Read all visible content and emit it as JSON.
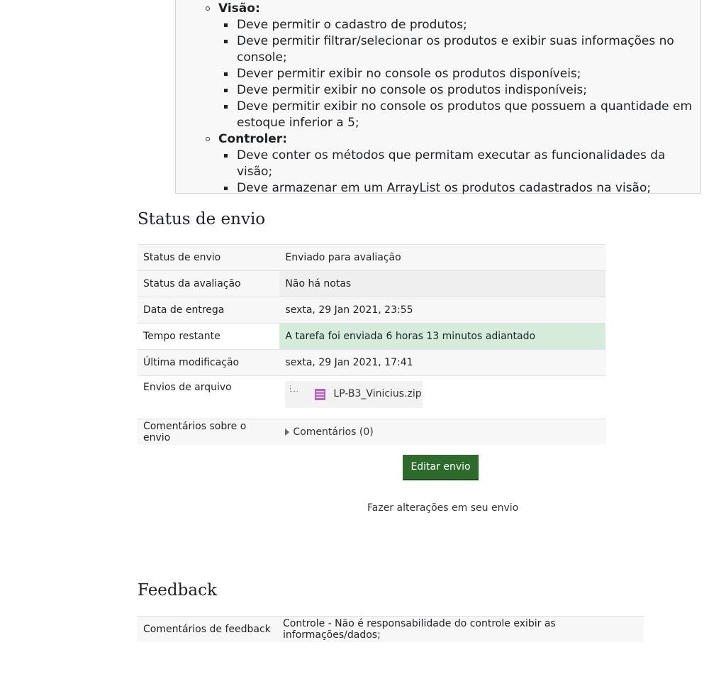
{
  "description": {
    "groups": [
      {
        "title": "Visão:",
        "items": [
          "Deve permitir o cadastro de produtos;",
          "Deve permitir filtrar/selecionar os produtos e exibir suas informações no console;",
          "Dever permitir exibir no console os produtos disponíveis;",
          "Deve permitir exibir no console os produtos indisponíveis;",
          "Deve permitir exibir no console os produtos que possuem a quantidade em estoque inferior a 5;"
        ]
      },
      {
        "title": "Controler:",
        "items": [
          "Deve conter os métodos que permitam executar as funcionalidades da visão;",
          "Deve armazenar em um ArrayList os produtos cadastrados na visão;"
        ]
      }
    ]
  },
  "submission_status": {
    "heading": "Status de envio",
    "rows": [
      {
        "label": "Status de envio",
        "value": "Enviado para avaliação"
      },
      {
        "label": "Status da avaliação",
        "value": "Não há notas"
      },
      {
        "label": "Data de entrega",
        "value": "sexta, 29 Jan 2021, 23:55"
      },
      {
        "label": "Tempo restante",
        "value": "A tarefa foi enviada 6 horas 13 minutos adiantado"
      },
      {
        "label": "Última modificação",
        "value": "sexta, 29 Jan 2021, 17:41"
      },
      {
        "label": "Envios de arquivo",
        "file_name": "LP-B3_Vinicius.zip",
        "file_icon": "zip-file-icon"
      },
      {
        "label": "Comentários sobre o envio",
        "comments_link": "Comentários (0)",
        "toggle_icon": "triangle-right-icon"
      }
    ],
    "colors": {
      "success_bg": "#d4edda",
      "button_bg": "#2b6c2a"
    }
  },
  "actions": {
    "edit_button": "Editar envio",
    "help_text": "Fazer alterações em seu envio"
  },
  "feedback": {
    "heading": "Feedback",
    "rows": [
      {
        "label": "Comentários de feedback",
        "value": "Controle - Não é responsabilidade do controle exibir as informações/dados;"
      }
    ]
  }
}
